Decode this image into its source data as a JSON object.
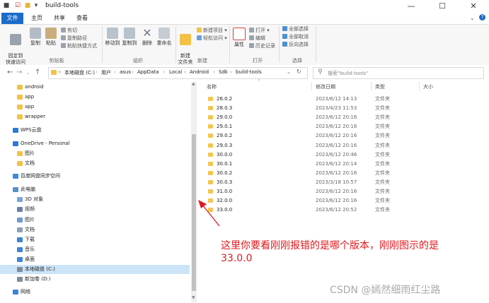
{
  "window": {
    "title": "build-tools"
  },
  "ribbon_tabs": [
    "文件",
    "主页",
    "共享",
    "查看"
  ],
  "ribbon": {
    "clipboard": {
      "pin": "固定到\n快速访问",
      "copy": "复制",
      "paste": "粘贴",
      "cut": "剪切",
      "copy_path": "复制路径",
      "paste_shortcut": "粘贴快捷方式",
      "group": "剪贴板"
    },
    "organize": {
      "move_to": "移动到",
      "copy_to": "复制到",
      "delete": "删除",
      "rename": "重命名",
      "group": "组织"
    },
    "new": {
      "new_folder": "新建\n文件夹",
      "new_item": "新建项目 ▾",
      "easy_access": "轻松访问 ▾",
      "group": "新建"
    },
    "open": {
      "properties": "属性",
      "open": "打开 ▾",
      "edit": "编辑",
      "history": "历史记录",
      "group": "打开"
    },
    "select": {
      "select_all": "全部选择",
      "select_none": "全部取消",
      "invert": "反向选择",
      "group": "选择"
    }
  },
  "breadcrumb": [
    "本地磁盘 (C:)",
    "用户",
    "asus",
    "AppData",
    "Local",
    "Android",
    "Sdk",
    "build-tools"
  ],
  "search": {
    "placeholder": "搜索\"build-tools\""
  },
  "sidebar": {
    "items": [
      {
        "label": "android",
        "icon": "folder-icon"
      },
      {
        "label": "app",
        "icon": "folder-icon"
      },
      {
        "label": "app",
        "icon": "folder-icon"
      },
      {
        "label": "wrapper",
        "icon": "folder-icon"
      },
      {
        "label": "WPS云盘",
        "icon": "cloud-icon"
      },
      {
        "label": "OneDrive - Personal",
        "icon": "cloud-icon"
      },
      {
        "label": "图片",
        "icon": "folder-icon"
      },
      {
        "label": "文档",
        "icon": "folder-icon"
      },
      {
        "label": "百度网盘同步空间",
        "icon": "sync-icon"
      },
      {
        "label": "此电脑",
        "icon": "pc-icon"
      },
      {
        "label": "3D 对象",
        "icon": "cube-icon"
      },
      {
        "label": "视频",
        "icon": "video-icon"
      },
      {
        "label": "图片",
        "icon": "picture-icon"
      },
      {
        "label": "文档",
        "icon": "document-icon"
      },
      {
        "label": "下载",
        "icon": "download-icon"
      },
      {
        "label": "音乐",
        "icon": "music-icon"
      },
      {
        "label": "桌面",
        "icon": "desktop-icon"
      },
      {
        "label": "本地磁盘 (C:)",
        "icon": "drive-icon"
      },
      {
        "label": "新加卷 (D:)",
        "icon": "drive-icon"
      },
      {
        "label": "网络",
        "icon": "network-icon"
      }
    ]
  },
  "columns": [
    "名称",
    "修改日期",
    "类型",
    "大小"
  ],
  "files": [
    {
      "name": "26.0.2",
      "date": "2023/6/12 14:13",
      "type": "文件夹"
    },
    {
      "name": "28.0.3",
      "date": "2023/4/23 11:53",
      "type": "文件夹"
    },
    {
      "name": "29.0.0",
      "date": "2023/6/12 20:16",
      "type": "文件夹"
    },
    {
      "name": "29.0.1",
      "date": "2023/6/12 20:16",
      "type": "文件夹"
    },
    {
      "name": "29.0.2",
      "date": "2023/6/12 20:16",
      "type": "文件夹"
    },
    {
      "name": "29.0.3",
      "date": "2023/6/12 20:16",
      "type": "文件夹"
    },
    {
      "name": "30.0.0",
      "date": "2023/6/12 20:46",
      "type": "文件夹"
    },
    {
      "name": "30.0.1",
      "date": "2023/6/12 20:14",
      "type": "文件夹"
    },
    {
      "name": "30.0.2",
      "date": "2023/6/12 20:16",
      "type": "文件夹"
    },
    {
      "name": "30.0.3",
      "date": "2023/3/18 10:57",
      "type": "文件夹"
    },
    {
      "name": "31.0.0",
      "date": "2023/6/12 20:16",
      "type": "文件夹"
    },
    {
      "name": "32.0.0",
      "date": "2023/6/12 20:16",
      "type": "文件夹"
    },
    {
      "name": "33.0.0",
      "date": "2023/6/12 20:52",
      "type": "文件夹"
    }
  ],
  "annotation": {
    "line1": "这里你要看刚刚报错的是哪个版本，刚刚图示的是",
    "line2": "33.0.0",
    "color": "#e0191e"
  },
  "watermark": "CSDN @嫣然细雨红尘路"
}
